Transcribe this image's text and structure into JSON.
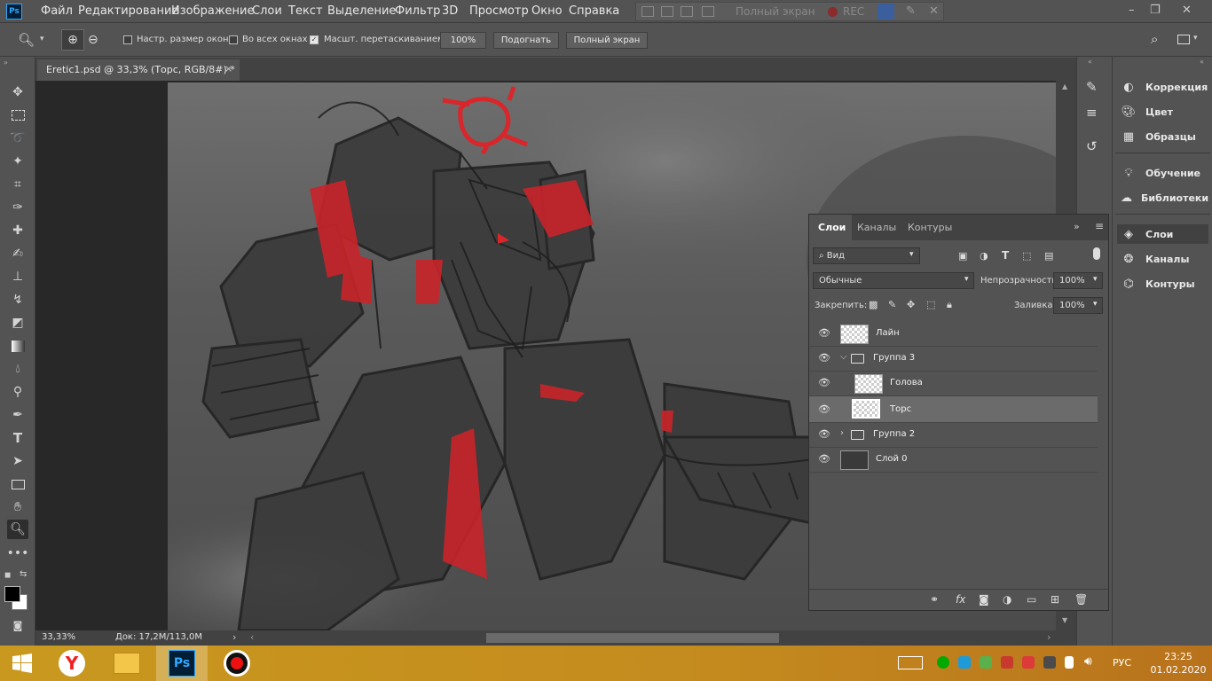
{
  "app": {
    "logo": "Ps",
    "menu": [
      "Файл",
      "Редактирование",
      "Изображение",
      "Слои",
      "Текст",
      "Выделение",
      "Фильтр",
      "3D",
      "Просмотр",
      "Окно",
      "Справка"
    ],
    "workspace": {
      "fullscreen": "Полный экран",
      "rec": "REC"
    },
    "window_buttons": [
      "–",
      "❐",
      "✕"
    ]
  },
  "options": {
    "resize_windows": "Настр. размер окон",
    "all_windows": "Во всех окнах",
    "scrubby_zoom": "Масшт. перетаскиванием",
    "zoom_value": "100%",
    "fit_button": "Подогнать",
    "fullscreen_button": "Полный экран"
  },
  "document": {
    "tab_title": "Eretic1.psd @ 33,3% (Торс, RGB/8#) *",
    "close": "×"
  },
  "status": {
    "zoom": "33,33%",
    "doc": "Док: 17,2M/113,0M"
  },
  "right_panel": {
    "items": [
      "Коррекция",
      "Цвет",
      "Образцы",
      "Обучение",
      "Библиотеки",
      "Слои",
      "Каналы",
      "Контуры"
    ]
  },
  "layers_panel": {
    "tabs": [
      "Слои",
      "Каналы",
      "Контуры"
    ],
    "filter": "Вид",
    "blend_mode": "Обычные",
    "opacity_label": "Непрозрачность:",
    "opacity_value": "100%",
    "lock_label": "Закрепить:",
    "fill_label": "Заливка:",
    "fill_value": "100%",
    "layers": [
      {
        "name": "Лайн",
        "type": "layer"
      },
      {
        "name": "Группа 3",
        "type": "group"
      },
      {
        "name": "Голова",
        "type": "layer"
      },
      {
        "name": "Торс",
        "type": "layer",
        "selected": true
      },
      {
        "name": "Группа 2",
        "type": "group"
      },
      {
        "name": "Слой 0",
        "type": "layer"
      }
    ]
  },
  "taskbar": {
    "lang": "РУС",
    "time": "23:25",
    "date": "01.02.2020",
    "apps": [
      "windows-start",
      "yandex-browser",
      "file-explorer",
      "photoshop",
      "recorder"
    ]
  },
  "colors": {
    "accent_red": "#d9262b",
    "ps_blue": "#31a8ff",
    "selection": "#6b6b6b"
  }
}
